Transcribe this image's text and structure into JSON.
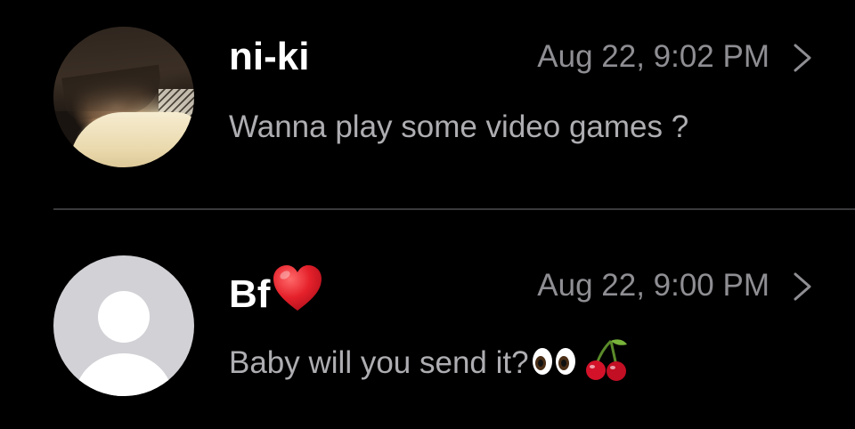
{
  "conversations": [
    {
      "name": "ni-ki",
      "timestamp": "Aug 22, 9:02 PM",
      "preview": "Wanna play some video games ?",
      "avatar": "photo"
    },
    {
      "name": "Bf",
      "name_emoji": "red-heart",
      "timestamp": "Aug 22, 9:00 PM",
      "preview": "Baby will you send it?",
      "preview_emojis": [
        "eyes",
        "cherries"
      ],
      "avatar": "default-silhouette"
    }
  ],
  "colors": {
    "background": "#000000",
    "name": "#ffffff",
    "timestamp": "#8e8e93",
    "preview": "#aeaeb2",
    "separator": "#3a3a3c",
    "default_avatar": "#d1d1d6"
  },
  "icons": {
    "disclosure": "chevron-right-icon"
  }
}
